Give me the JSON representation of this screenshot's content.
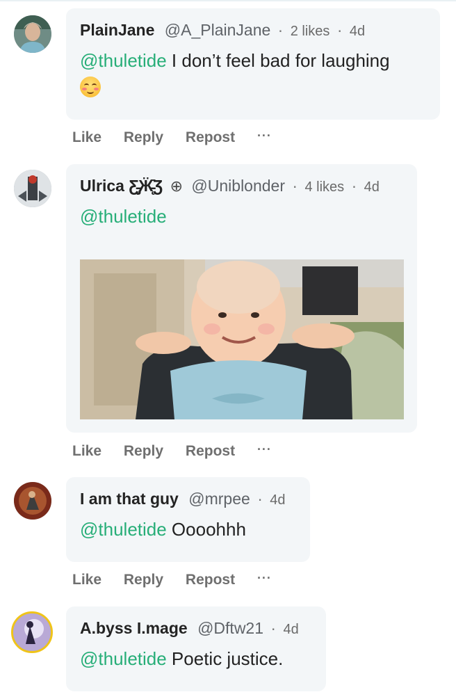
{
  "comments": [
    {
      "name": "PlainJane",
      "handle": "@A_PlainJane",
      "likes": "2 likes",
      "time": "4d",
      "mention": "@thuletide",
      "text": " I don’t feel bad for laughing",
      "emoji": "smiling-face-with-blush-icon"
    },
    {
      "name": "Ulrica Ƹ̵̡Ӝ̵̨̄Ʒ",
      "badge": "⊕",
      "handle": "@Uniblonder",
      "likes": "4 likes",
      "time": "4d",
      "mention": "@thuletide",
      "text": ""
    },
    {
      "name": "I am that guy",
      "handle": "@mrpee",
      "time": "4d",
      "mention": "@thuletide",
      "text": " Oooohhh"
    },
    {
      "name": "A.byss I.mage",
      "handle": "@Dftw21",
      "time": "4d",
      "mention": "@thuletide",
      "text": " Poetic justice."
    }
  ],
  "actions": {
    "like": "Like",
    "reply": "Reply",
    "repost": "Repost",
    "more": "···"
  },
  "sep": "·",
  "colors": {
    "mention": "#27ae78",
    "bubble": "#f3f6f8"
  }
}
